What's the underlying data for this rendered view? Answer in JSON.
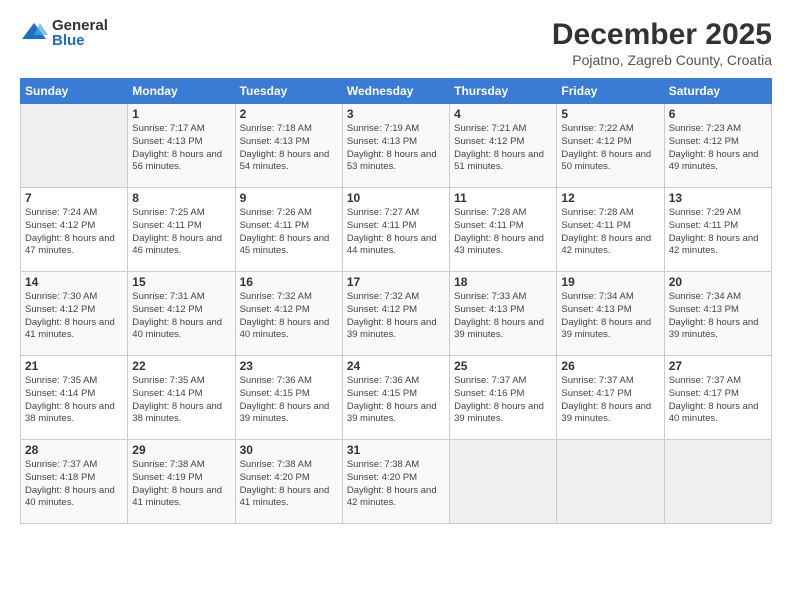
{
  "logo": {
    "general": "General",
    "blue": "Blue"
  },
  "header": {
    "month": "December 2025",
    "location": "Pojatno, Zagreb County, Croatia"
  },
  "weekdays": [
    "Sunday",
    "Monday",
    "Tuesday",
    "Wednesday",
    "Thursday",
    "Friday",
    "Saturday"
  ],
  "weeks": [
    [
      {
        "day": "",
        "sunrise": "",
        "sunset": "",
        "daylight": ""
      },
      {
        "day": "1",
        "sunrise": "Sunrise: 7:17 AM",
        "sunset": "Sunset: 4:13 PM",
        "daylight": "Daylight: 8 hours and 56 minutes."
      },
      {
        "day": "2",
        "sunrise": "Sunrise: 7:18 AM",
        "sunset": "Sunset: 4:13 PM",
        "daylight": "Daylight: 8 hours and 54 minutes."
      },
      {
        "day": "3",
        "sunrise": "Sunrise: 7:19 AM",
        "sunset": "Sunset: 4:13 PM",
        "daylight": "Daylight: 8 hours and 53 minutes."
      },
      {
        "day": "4",
        "sunrise": "Sunrise: 7:21 AM",
        "sunset": "Sunset: 4:12 PM",
        "daylight": "Daylight: 8 hours and 51 minutes."
      },
      {
        "day": "5",
        "sunrise": "Sunrise: 7:22 AM",
        "sunset": "Sunset: 4:12 PM",
        "daylight": "Daylight: 8 hours and 50 minutes."
      },
      {
        "day": "6",
        "sunrise": "Sunrise: 7:23 AM",
        "sunset": "Sunset: 4:12 PM",
        "daylight": "Daylight: 8 hours and 49 minutes."
      }
    ],
    [
      {
        "day": "7",
        "sunrise": "Sunrise: 7:24 AM",
        "sunset": "Sunset: 4:12 PM",
        "daylight": "Daylight: 8 hours and 47 minutes."
      },
      {
        "day": "8",
        "sunrise": "Sunrise: 7:25 AM",
        "sunset": "Sunset: 4:11 PM",
        "daylight": "Daylight: 8 hours and 46 minutes."
      },
      {
        "day": "9",
        "sunrise": "Sunrise: 7:26 AM",
        "sunset": "Sunset: 4:11 PM",
        "daylight": "Daylight: 8 hours and 45 minutes."
      },
      {
        "day": "10",
        "sunrise": "Sunrise: 7:27 AM",
        "sunset": "Sunset: 4:11 PM",
        "daylight": "Daylight: 8 hours and 44 minutes."
      },
      {
        "day": "11",
        "sunrise": "Sunrise: 7:28 AM",
        "sunset": "Sunset: 4:11 PM",
        "daylight": "Daylight: 8 hours and 43 minutes."
      },
      {
        "day": "12",
        "sunrise": "Sunrise: 7:28 AM",
        "sunset": "Sunset: 4:11 PM",
        "daylight": "Daylight: 8 hours and 42 minutes."
      },
      {
        "day": "13",
        "sunrise": "Sunrise: 7:29 AM",
        "sunset": "Sunset: 4:11 PM",
        "daylight": "Daylight: 8 hours and 42 minutes."
      }
    ],
    [
      {
        "day": "14",
        "sunrise": "Sunrise: 7:30 AM",
        "sunset": "Sunset: 4:12 PM",
        "daylight": "Daylight: 8 hours and 41 minutes."
      },
      {
        "day": "15",
        "sunrise": "Sunrise: 7:31 AM",
        "sunset": "Sunset: 4:12 PM",
        "daylight": "Daylight: 8 hours and 40 minutes."
      },
      {
        "day": "16",
        "sunrise": "Sunrise: 7:32 AM",
        "sunset": "Sunset: 4:12 PM",
        "daylight": "Daylight: 8 hours and 40 minutes."
      },
      {
        "day": "17",
        "sunrise": "Sunrise: 7:32 AM",
        "sunset": "Sunset: 4:12 PM",
        "daylight": "Daylight: 8 hours and 39 minutes."
      },
      {
        "day": "18",
        "sunrise": "Sunrise: 7:33 AM",
        "sunset": "Sunset: 4:13 PM",
        "daylight": "Daylight: 8 hours and 39 minutes."
      },
      {
        "day": "19",
        "sunrise": "Sunrise: 7:34 AM",
        "sunset": "Sunset: 4:13 PM",
        "daylight": "Daylight: 8 hours and 39 minutes."
      },
      {
        "day": "20",
        "sunrise": "Sunrise: 7:34 AM",
        "sunset": "Sunset: 4:13 PM",
        "daylight": "Daylight: 8 hours and 39 minutes."
      }
    ],
    [
      {
        "day": "21",
        "sunrise": "Sunrise: 7:35 AM",
        "sunset": "Sunset: 4:14 PM",
        "daylight": "Daylight: 8 hours and 38 minutes."
      },
      {
        "day": "22",
        "sunrise": "Sunrise: 7:35 AM",
        "sunset": "Sunset: 4:14 PM",
        "daylight": "Daylight: 8 hours and 38 minutes."
      },
      {
        "day": "23",
        "sunrise": "Sunrise: 7:36 AM",
        "sunset": "Sunset: 4:15 PM",
        "daylight": "Daylight: 8 hours and 39 minutes."
      },
      {
        "day": "24",
        "sunrise": "Sunrise: 7:36 AM",
        "sunset": "Sunset: 4:15 PM",
        "daylight": "Daylight: 8 hours and 39 minutes."
      },
      {
        "day": "25",
        "sunrise": "Sunrise: 7:37 AM",
        "sunset": "Sunset: 4:16 PM",
        "daylight": "Daylight: 8 hours and 39 minutes."
      },
      {
        "day": "26",
        "sunrise": "Sunrise: 7:37 AM",
        "sunset": "Sunset: 4:17 PM",
        "daylight": "Daylight: 8 hours and 39 minutes."
      },
      {
        "day": "27",
        "sunrise": "Sunrise: 7:37 AM",
        "sunset": "Sunset: 4:17 PM",
        "daylight": "Daylight: 8 hours and 40 minutes."
      }
    ],
    [
      {
        "day": "28",
        "sunrise": "Sunrise: 7:37 AM",
        "sunset": "Sunset: 4:18 PM",
        "daylight": "Daylight: 8 hours and 40 minutes."
      },
      {
        "day": "29",
        "sunrise": "Sunrise: 7:38 AM",
        "sunset": "Sunset: 4:19 PM",
        "daylight": "Daylight: 8 hours and 41 minutes."
      },
      {
        "day": "30",
        "sunrise": "Sunrise: 7:38 AM",
        "sunset": "Sunset: 4:20 PM",
        "daylight": "Daylight: 8 hours and 41 minutes."
      },
      {
        "day": "31",
        "sunrise": "Sunrise: 7:38 AM",
        "sunset": "Sunset: 4:20 PM",
        "daylight": "Daylight: 8 hours and 42 minutes."
      },
      {
        "day": "",
        "sunrise": "",
        "sunset": "",
        "daylight": ""
      },
      {
        "day": "",
        "sunrise": "",
        "sunset": "",
        "daylight": ""
      },
      {
        "day": "",
        "sunrise": "",
        "sunset": "",
        "daylight": ""
      }
    ]
  ]
}
